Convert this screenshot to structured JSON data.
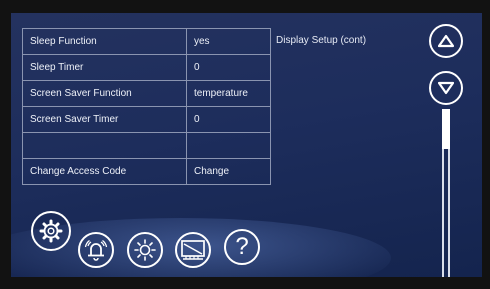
{
  "title": "Display Setup (cont)",
  "settings": [
    {
      "label": "Sleep Function",
      "value": "yes"
    },
    {
      "label": "Sleep Timer",
      "value": "0"
    },
    {
      "label": "Screen Saver Function",
      "value": "temperature"
    },
    {
      "label": "Screen Saver Timer",
      "value": "0"
    },
    {
      "label": "",
      "value": ""
    },
    {
      "label": "Change Access Code",
      "value": "Change"
    }
  ],
  "nav": {
    "icons": [
      "gear-icon",
      "alarm-bell-icon",
      "brightness-icon",
      "display-icon",
      "help-icon"
    ],
    "help_label": "?"
  },
  "scroll": {
    "up_icon": "chevron-up-icon",
    "down_icon": "chevron-down-icon"
  },
  "colors": {
    "background": "#1d2d5c",
    "frame": "#121212",
    "text": "#eef1f8",
    "border": "#8a94b0"
  }
}
